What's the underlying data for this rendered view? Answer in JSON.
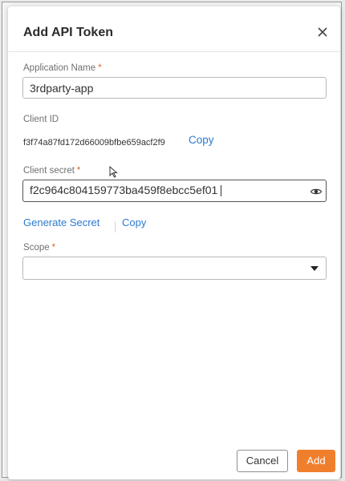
{
  "dialog": {
    "title": "Add API Token",
    "close_icon": "close-icon"
  },
  "fields": {
    "application_name": {
      "label": "Application Name",
      "required_mark": "*",
      "value": "3rdparty-app"
    },
    "client_id": {
      "label": "Client ID",
      "value": "f3f74a87fd172d66009bfbe659acf2f9",
      "copy_label": "Copy"
    },
    "client_secret": {
      "label": "Client secret",
      "required_mark": "*",
      "value": "f2c964c804159773ba459f8ebcc5ef01",
      "icon": "eye-icon"
    },
    "secret_actions": {
      "generate_label": "Generate Secret",
      "copy_label": "Copy"
    },
    "scope": {
      "label": "Scope",
      "required_mark": "*",
      "value": "",
      "icon": "chevron-down-icon"
    }
  },
  "footer": {
    "cancel_label": "Cancel",
    "add_label": "Add"
  },
  "colors": {
    "accent": "#f07f2d",
    "link": "#2a7bd1",
    "required": "#e3652b"
  }
}
